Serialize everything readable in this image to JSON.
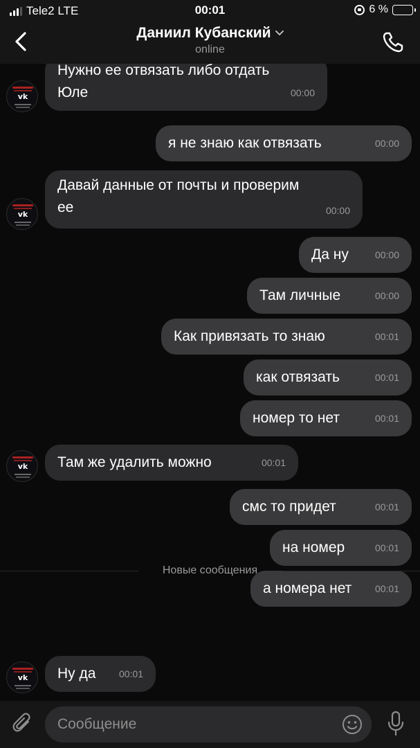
{
  "status_bar": {
    "carrier": "Tele2 LTE",
    "time": "00:01",
    "battery": "6 %",
    "battery_level": 0.06
  },
  "header": {
    "title": "Даниил Кубанский",
    "subtitle": "online",
    "icons": [
      "back-arrow-icon",
      "chevron-down-icon",
      "phone-icon"
    ]
  },
  "messages": [
    {
      "dir": "in",
      "lines": [
        "Нужно ее отвязать либо отдать",
        "Юле"
      ],
      "time": "00:00",
      "avatar": true
    },
    {
      "dir": "out",
      "lines": [
        "я не знаю как отвязать"
      ],
      "time": "00:00"
    },
    {
      "dir": "in",
      "lines": [
        "Давай данные от почты и проверим",
        "ее"
      ],
      "time": "00:00",
      "avatar": true
    },
    {
      "dir": "out",
      "lines": [
        "Да ну"
      ],
      "time": "00:00"
    },
    {
      "dir": "out",
      "lines": [
        "Там личные"
      ],
      "time": "00:00"
    },
    {
      "dir": "out",
      "lines": [
        "Как привязать то знаю"
      ],
      "time": "00:01"
    },
    {
      "dir": "out",
      "lines": [
        "как отвязать"
      ],
      "time": "00:01"
    },
    {
      "dir": "out",
      "lines": [
        "номер то нет"
      ],
      "time": "00:01"
    },
    {
      "dir": "in",
      "lines": [
        "Там же удалить можно"
      ],
      "time": "00:01",
      "avatar": true
    },
    {
      "dir": "out",
      "lines": [
        "смс то придет"
      ],
      "time": "00:01"
    },
    {
      "dir": "out",
      "lines": [
        "на номер"
      ],
      "time": "00:01"
    },
    {
      "dir": "out",
      "lines": [
        "а номера нет"
      ],
      "time": "00:01"
    },
    {
      "dir": "in",
      "lines": [
        "Ну да"
      ],
      "time": "00:01",
      "avatar": true
    }
  ],
  "divider": {
    "label": "Новые сообщения"
  },
  "input": {
    "placeholder": "Сообщение",
    "icons": [
      "attach-icon",
      "emoji-icon",
      "mic-icon"
    ]
  }
}
